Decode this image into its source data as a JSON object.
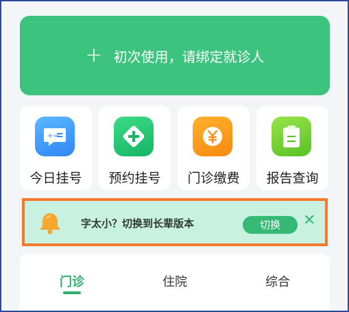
{
  "bind_card": {
    "icon": "plus-icon",
    "label": "初次使用，请绑定就诊人"
  },
  "services": [
    {
      "label": "今日挂号",
      "icon": "calculator-chat-icon"
    },
    {
      "label": "预约挂号",
      "icon": "medical-cross-icon"
    },
    {
      "label": "门诊缴费",
      "icon": "yuan-coin-icon"
    },
    {
      "label": "报告查询",
      "icon": "clipboard-icon"
    }
  ],
  "banner": {
    "icon": "bell-icon",
    "text": "字太小？切换到长辈版本",
    "button": "切换",
    "close_icon": "close-icon"
  },
  "tabs": [
    {
      "label": "门诊",
      "active": true
    },
    {
      "label": "住院"
    },
    {
      "label": "综合"
    }
  ],
  "colors": {
    "accent_green": "#3cc37e",
    "banner_bg": "#c9f1df",
    "highlight_border": "#f5792a"
  }
}
